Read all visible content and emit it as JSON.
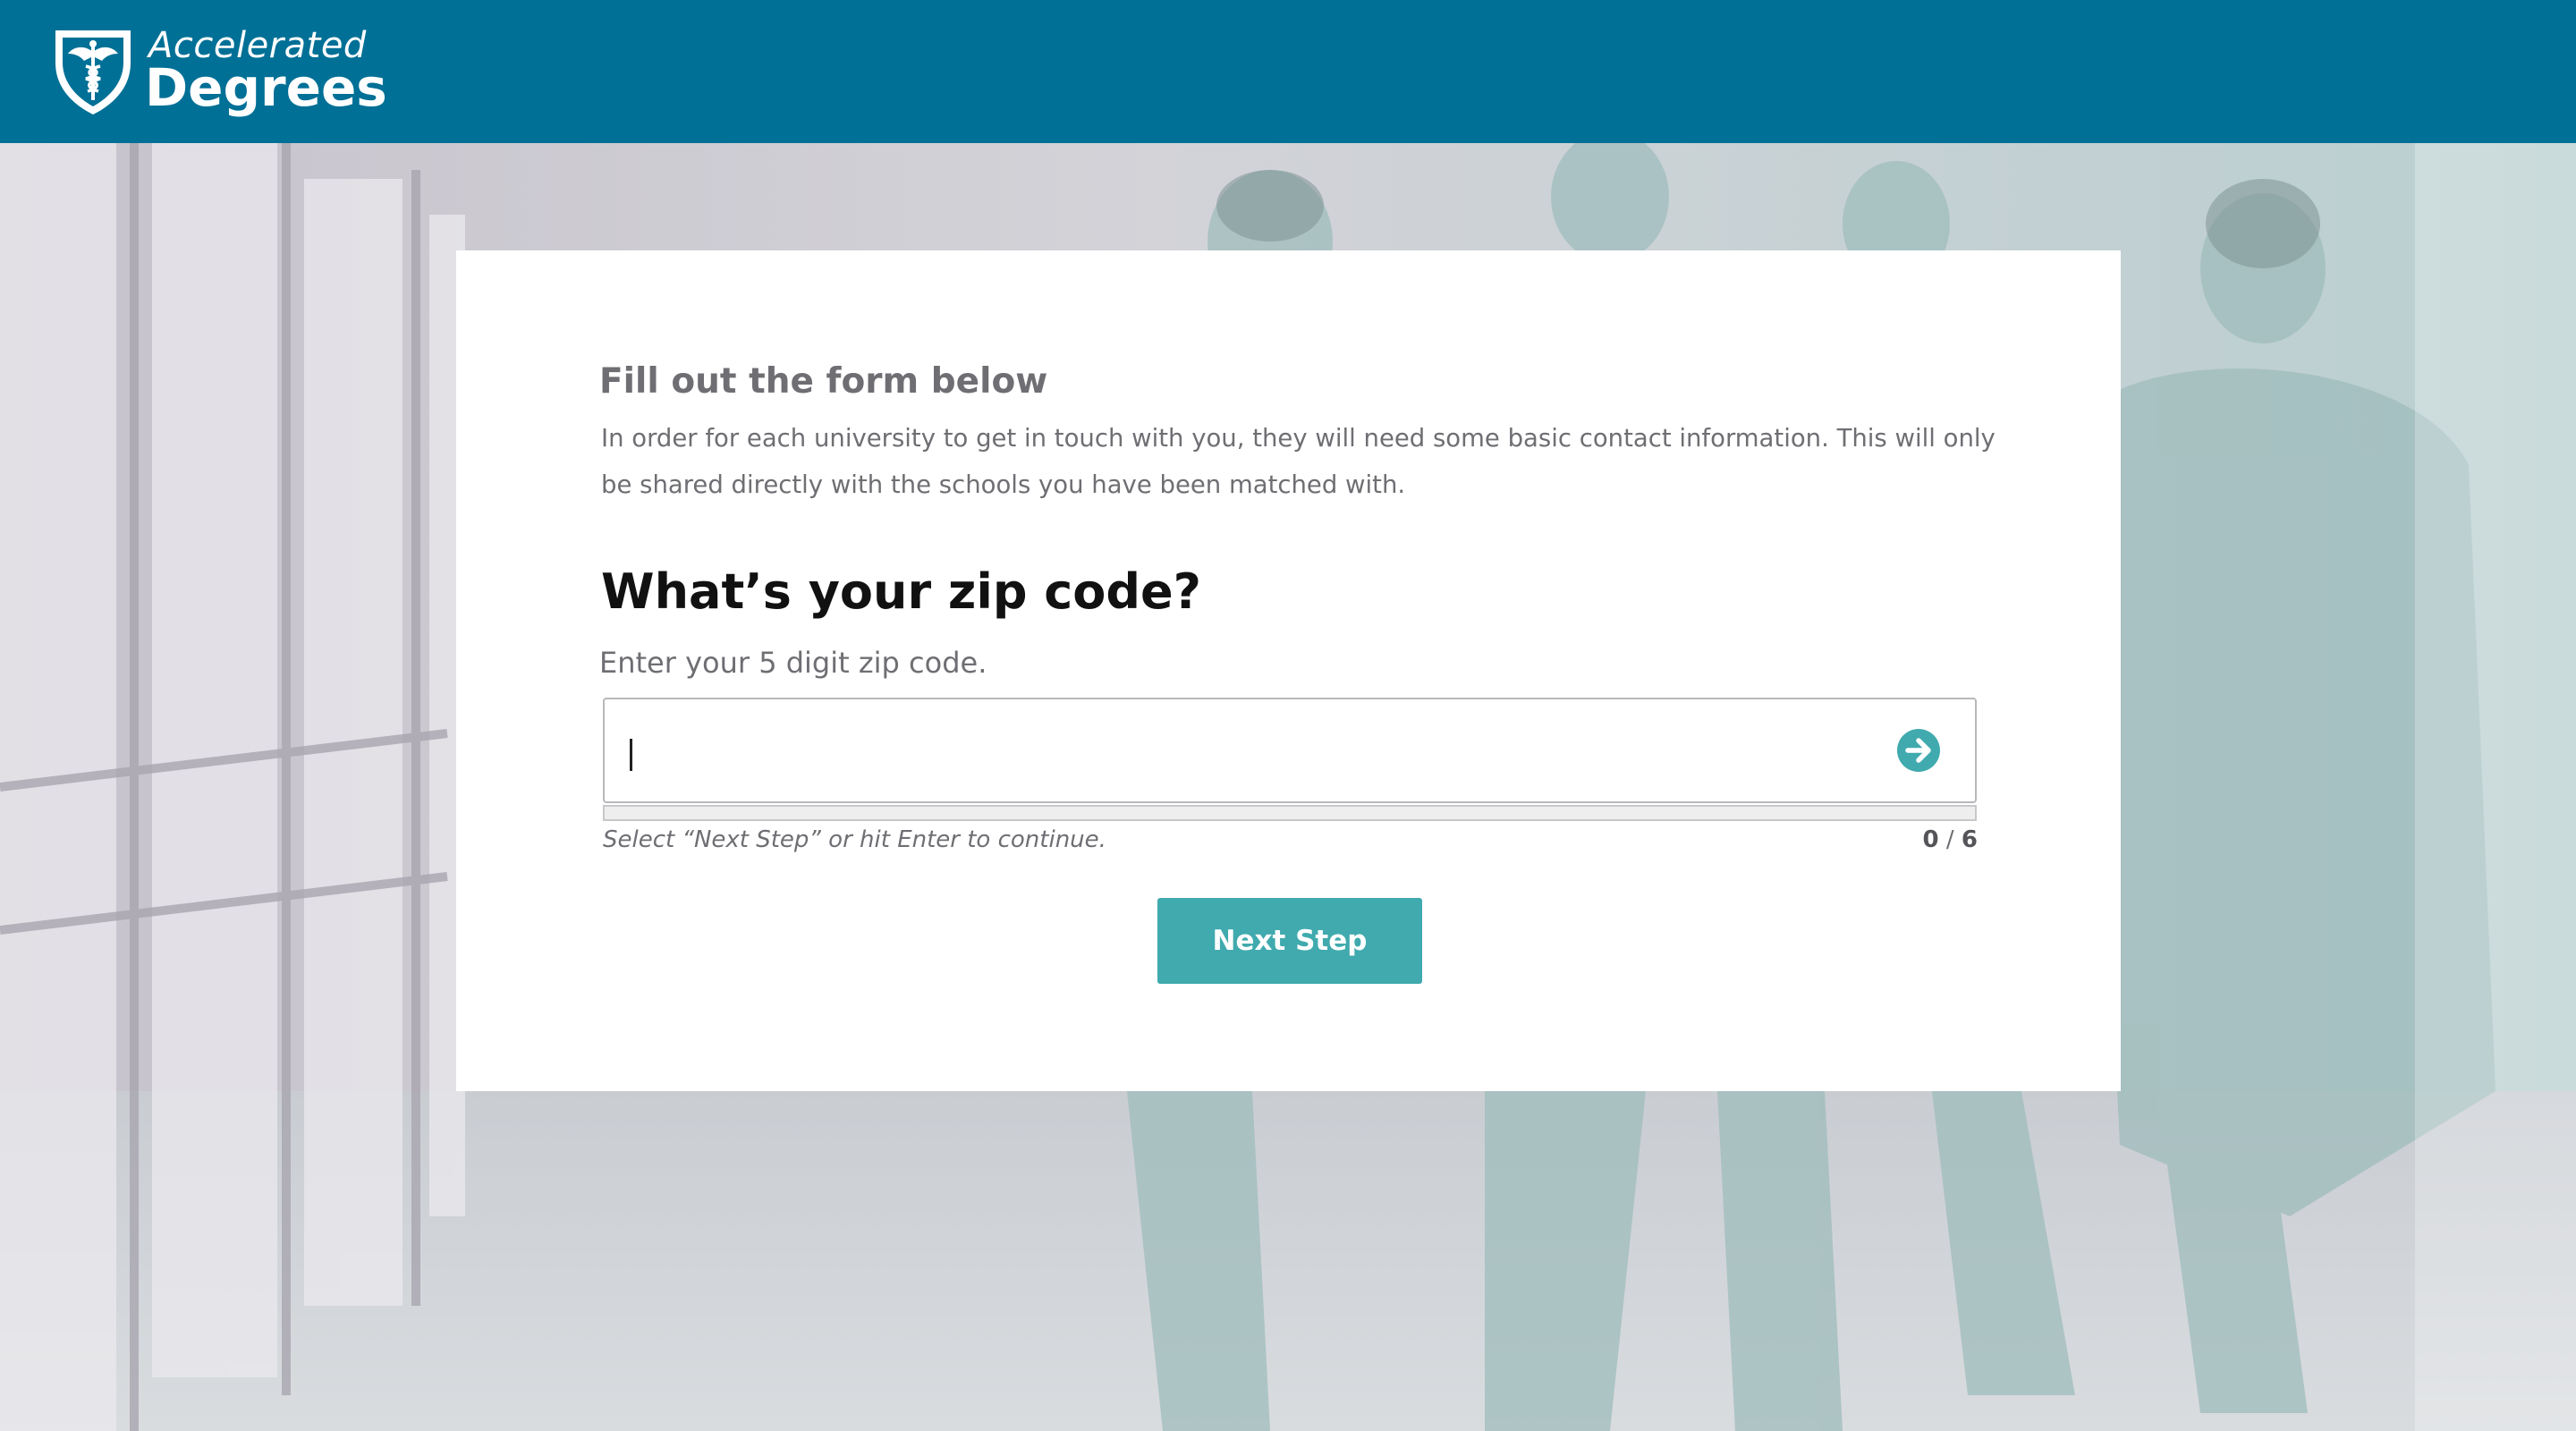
{
  "brand": {
    "name_line1": "Accelerated",
    "name_line2": "Degrees",
    "header_color": "#007096",
    "accent_color": "#40aaae",
    "logo_icon": "caduceus-shield-icon"
  },
  "form": {
    "heading": "Fill out the form below",
    "intro": "In order for each university to get in touch with you, they will need some basic contact information. This will only be shared directly with the schools you have been matched with.",
    "question": "What’s your zip code?",
    "hint": "Enter your 5 digit zip code.",
    "zip_value": "",
    "submit_icon": "arrow-right-circle-icon",
    "continue_note": "Select “Next Step” or hit Enter to continue.",
    "progress": {
      "current": "0",
      "separator": "/",
      "total": "6",
      "fraction": 0
    },
    "next_label": "Next Step"
  },
  "background": {
    "description_icon": "hospital-corridor-photo"
  }
}
